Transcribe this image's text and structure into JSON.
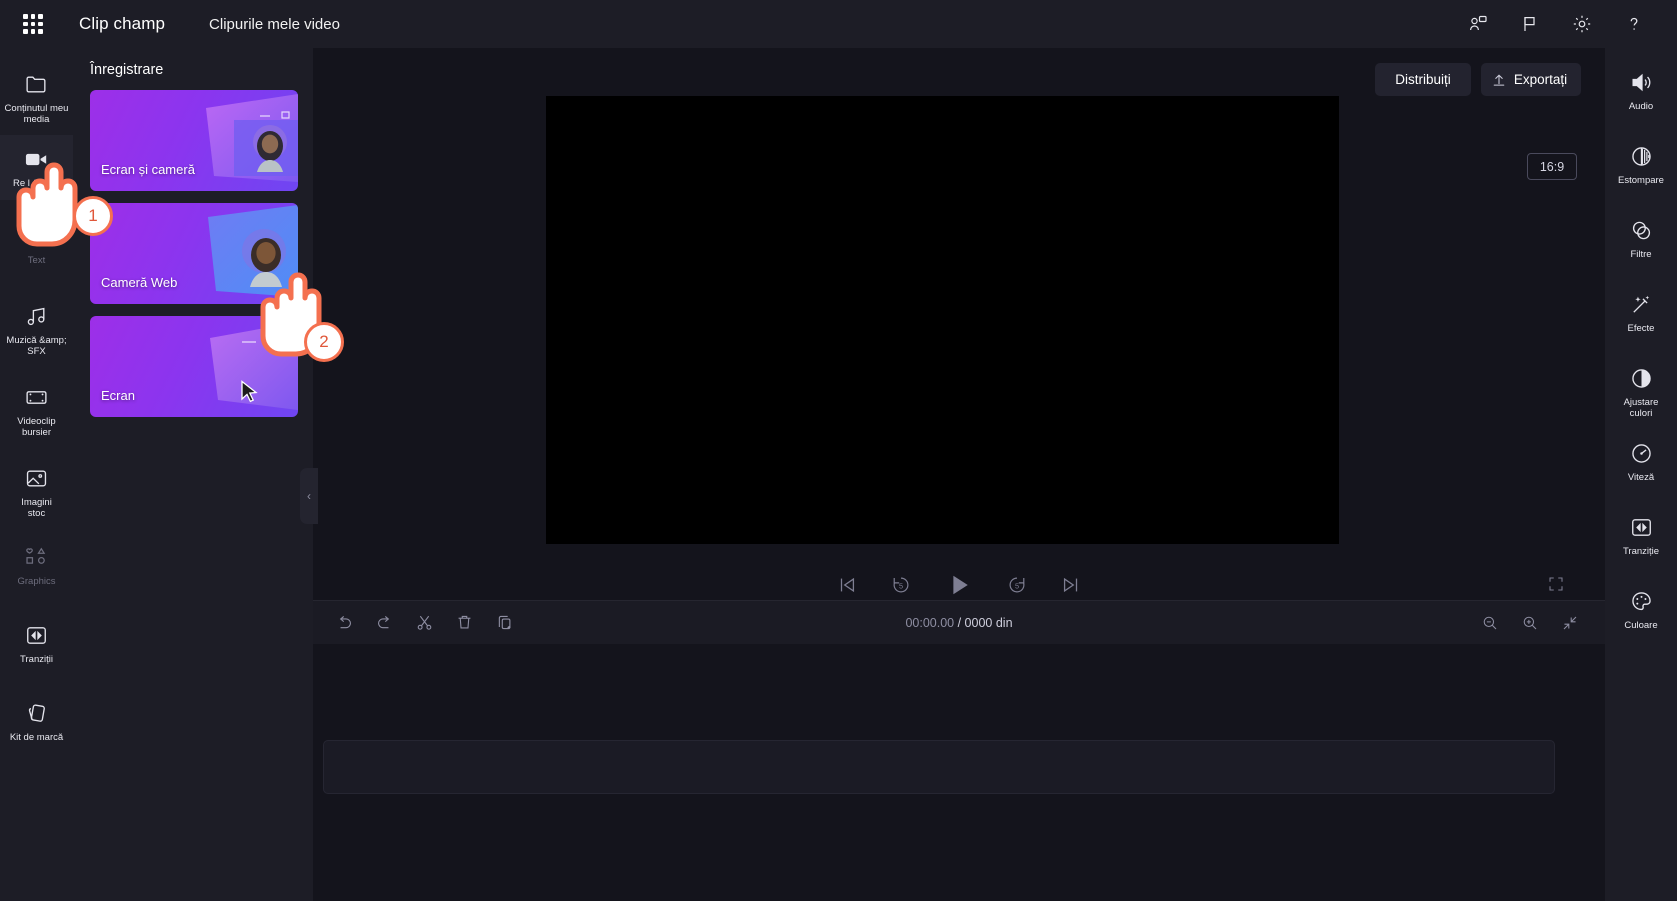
{
  "app": {
    "brand": "Clip champ",
    "project_name": "Clipurile mele video",
    "waffle_icon": "app-launcher-icon"
  },
  "header_icons": [
    {
      "name": "collaborate-icon",
      "glyph": "person-chat"
    },
    {
      "name": "flag-icon",
      "glyph": "flag"
    },
    {
      "name": "settings-icon",
      "glyph": "gear"
    },
    {
      "name": "help-icon",
      "glyph": "question-mark"
    }
  ],
  "left_rail": {
    "items": [
      {
        "label": "Conținutul meu media",
        "icon": "folder-icon",
        "state": "normal"
      },
      {
        "label": "Re l &amp;\ncamer",
        "icon": "video-camera-icon",
        "state": "active"
      },
      {
        "label": "Text",
        "icon": "text-icon",
        "state": "dim"
      },
      {
        "label": "Muzică &amp; SFX",
        "icon": "music-note-icon",
        "state": "normal"
      },
      {
        "label": "Videoclip bursier",
        "icon": "film-strip-icon",
        "state": "normal"
      },
      {
        "label": "Imagini\nstoc",
        "icon": "image-icon",
        "state": "normal"
      },
      {
        "label": "Graphics",
        "icon": "shapes-icon",
        "state": "dim"
      },
      {
        "label": "Tranziții",
        "icon": "transition-icon",
        "state": "normal"
      },
      {
        "label": "Kit de marcă",
        "icon": "brand-kit-icon",
        "state": "normal"
      }
    ]
  },
  "record_panel": {
    "title": "Înregistrare",
    "collapse_icon": "chevron-left-icon",
    "cards": [
      {
        "label": "Ecran și cameră",
        "name": "screen-and-camera"
      },
      {
        "label": "Cameră Web",
        "name": "webcam"
      },
      {
        "label": "Ecran",
        "name": "screen"
      }
    ]
  },
  "stage": {
    "share_label": "Distribuiți",
    "export_label": "Exportați",
    "export_icon": "upload-icon",
    "aspect_ratio": "16:9",
    "fullscreen_icon": "fullscreen-icon",
    "collapse_icon": "chevron-left-icon",
    "transport": [
      {
        "name": "skip-to-start-icon"
      },
      {
        "name": "rewind-5-icon"
      },
      {
        "name": "play-icon"
      },
      {
        "name": "forward-5-icon"
      },
      {
        "name": "skip-to-end-icon"
      }
    ]
  },
  "timeline": {
    "tools": [
      {
        "name": "undo-icon"
      },
      {
        "name": "redo-icon"
      },
      {
        "name": "split-icon"
      },
      {
        "name": "delete-icon"
      },
      {
        "name": "duplicate-icon"
      }
    ],
    "current_time": "00:00.00",
    "duration": "/ 0000 din",
    "zoom_tools": [
      {
        "name": "zoom-out-icon"
      },
      {
        "name": "zoom-in-icon"
      },
      {
        "name": "fit-to-screen-icon"
      }
    ]
  },
  "right_rail": {
    "items": [
      {
        "label": "Audio",
        "icon": "speaker-icon"
      },
      {
        "label": "Estompare",
        "icon": "fade-icon"
      },
      {
        "label": "Filtre",
        "icon": "filters-icon"
      },
      {
        "label": "Efecte",
        "icon": "effects-wand-icon"
      },
      {
        "label": "Ajustare\nculori",
        "icon": "color-adjust-icon"
      },
      {
        "label": "Viteză",
        "icon": "speed-gauge-icon"
      },
      {
        "label": "Tranziție",
        "icon": "transition-icon"
      },
      {
        "label": "Culoare",
        "icon": "color-palette-icon"
      }
    ]
  },
  "annotations": {
    "step_one": "1",
    "step_two": "2"
  },
  "colors": {
    "accent": "#f4704f",
    "panel_bg": "#1d1d26",
    "app_bg": "#14141c",
    "card_gradient_start": "#9d2fe8",
    "card_gradient_end": "#6f46f2"
  }
}
